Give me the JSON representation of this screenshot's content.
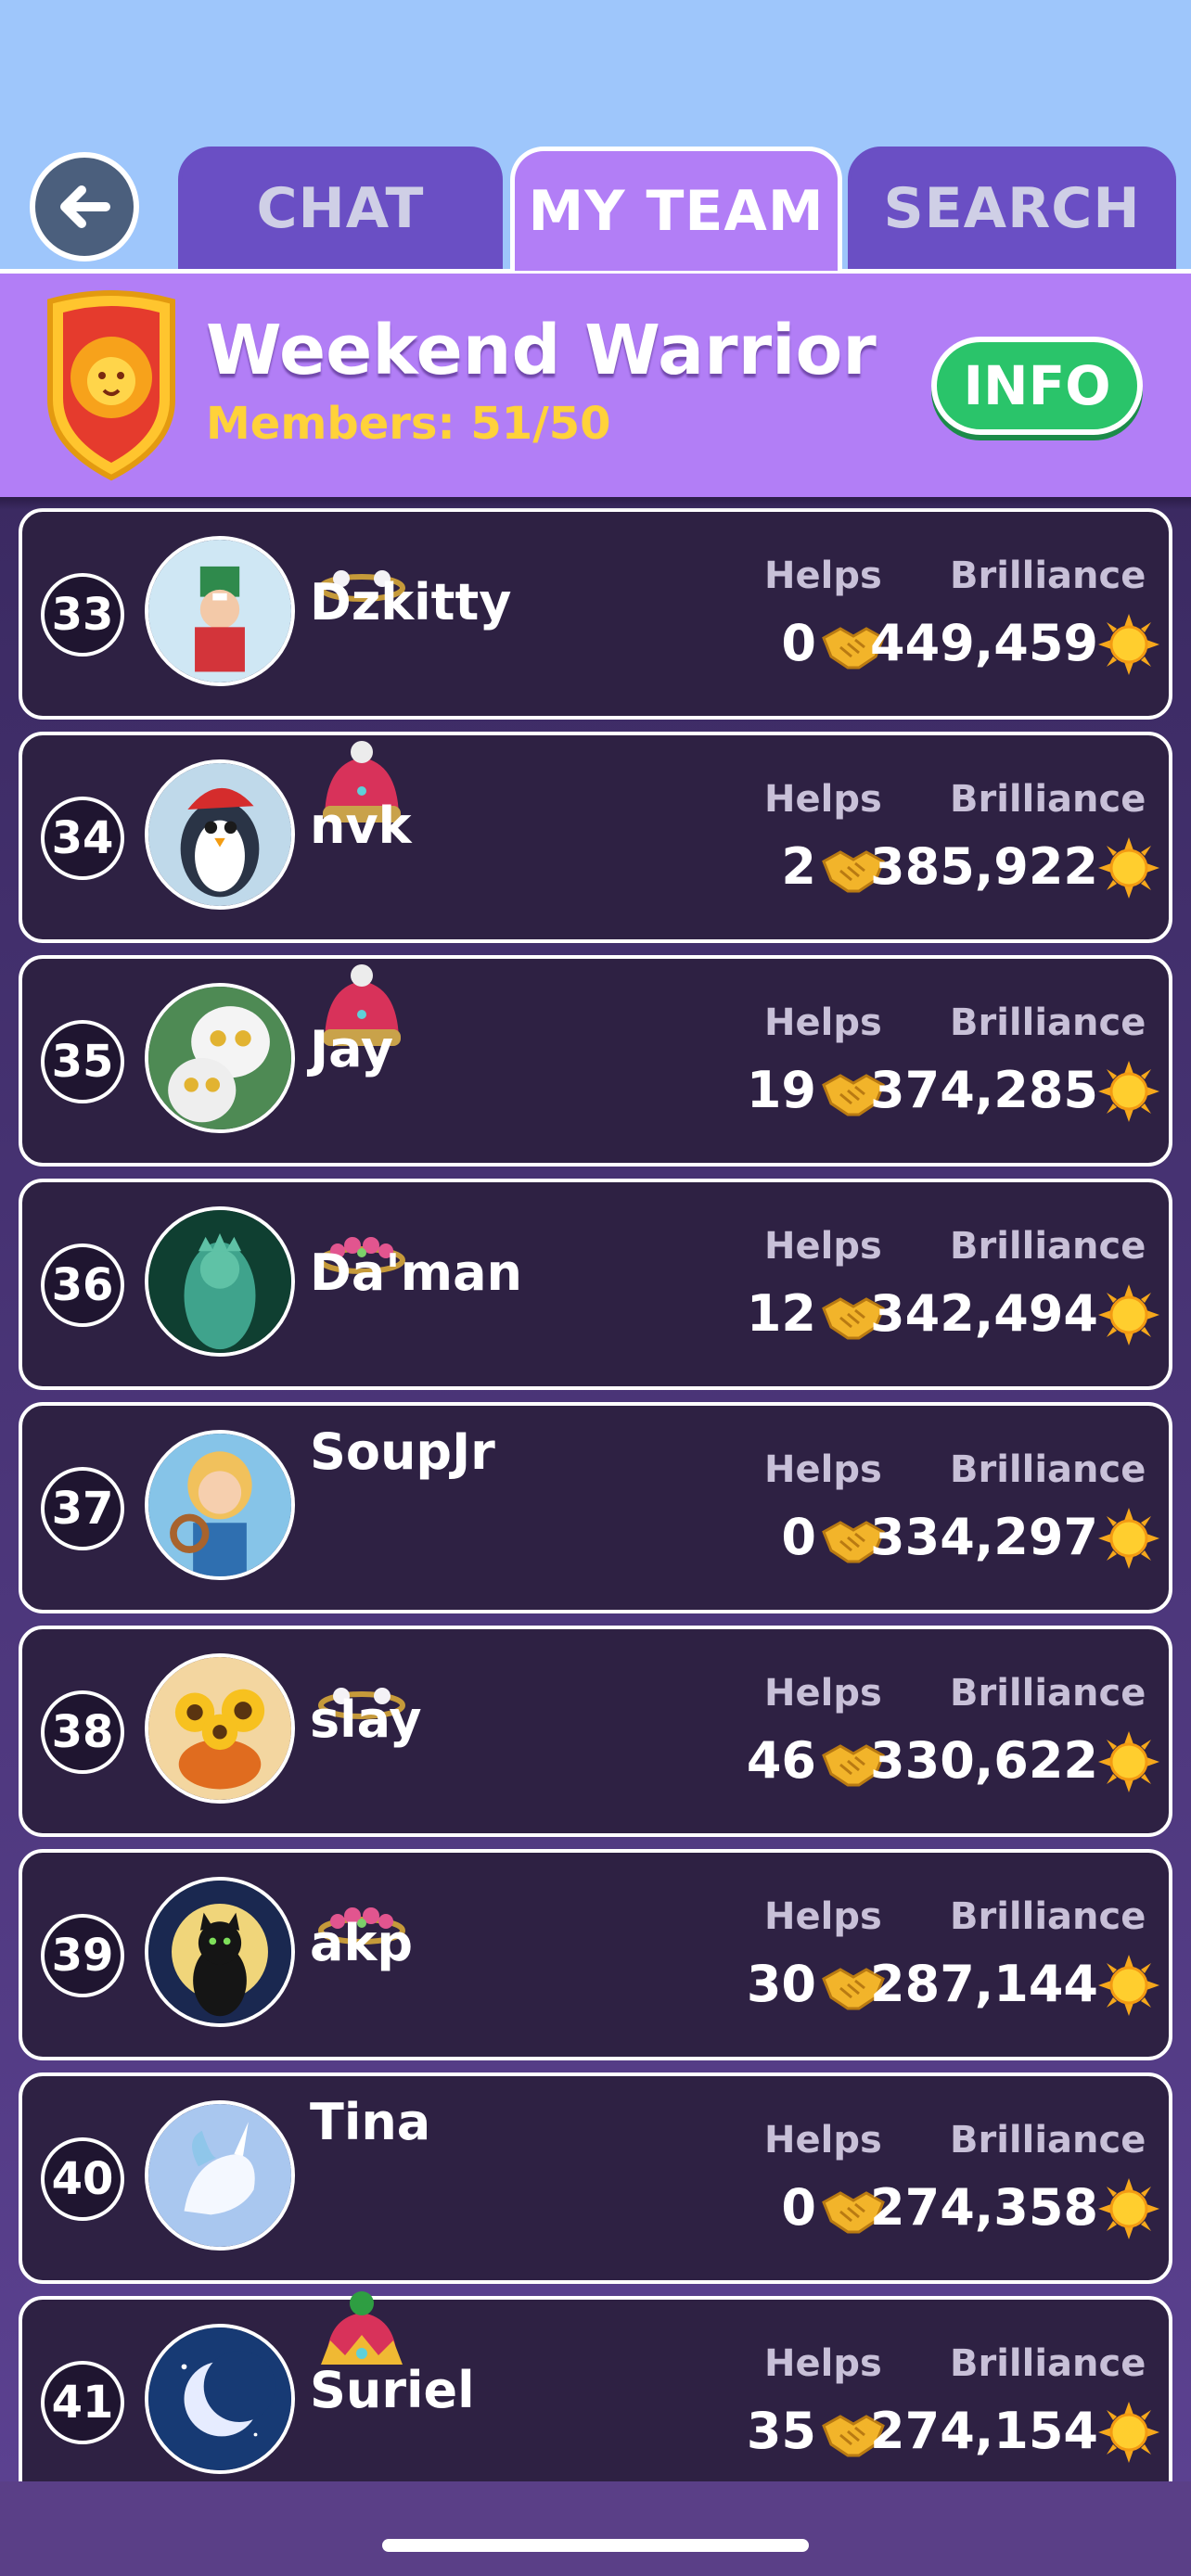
{
  "header": {
    "back_icon": "arrow-left-icon",
    "tabs": [
      {
        "label": "CHAT",
        "active": false
      },
      {
        "label": "MY TEAM",
        "active": true
      },
      {
        "label": "SEARCH",
        "active": false
      }
    ]
  },
  "team": {
    "name": "Weekend Warrior",
    "members_label": "Members: 51/50",
    "info_label": "INFO",
    "badge_icon": "lion-shield-icon"
  },
  "columns": {
    "helps_label": "Helps",
    "brilliance_label": "Brilliance"
  },
  "members": [
    {
      "rank": "33",
      "name": "Dzkitty",
      "helps": "0",
      "brilliance": "449,459",
      "crown": "pearl-tiara",
      "avatar": "nutcracker-avatar"
    },
    {
      "rank": "34",
      "name": "nvk",
      "helps": "2",
      "brilliance": "385,922",
      "crown": "pink-knit-hat",
      "avatar": "penguin-avatar"
    },
    {
      "rank": "35",
      "name": "Jay",
      "helps": "19",
      "brilliance": "374,285",
      "crown": "pink-knit-hat",
      "avatar": "snowy-owls-avatar"
    },
    {
      "rank": "36",
      "name": "Da'man",
      "helps": "12",
      "brilliance": "342,494",
      "crown": "flower-tiara",
      "avatar": "liberty-statue-avatar"
    },
    {
      "rank": "37",
      "name": "SoupJr",
      "helps": "0",
      "brilliance": "334,297",
      "crown": "",
      "avatar": "pretzel-girl-avatar"
    },
    {
      "rank": "38",
      "name": "slay",
      "helps": "46",
      "brilliance": "330,622",
      "crown": "pearl-tiara",
      "avatar": "sunflowers-avatar"
    },
    {
      "rank": "39",
      "name": "akp",
      "helps": "30",
      "brilliance": "287,144",
      "crown": "flower-tiara",
      "avatar": "black-cat-avatar"
    },
    {
      "rank": "40",
      "name": "Tina",
      "helps": "0",
      "brilliance": "274,358",
      "crown": "",
      "avatar": "unicorn-avatar"
    },
    {
      "rank": "41",
      "name": "Suriel",
      "helps": "35",
      "brilliance": "274,154",
      "crown": "jeweled-crown-hat",
      "avatar": "crescent-moon-avatar"
    }
  ],
  "colors": {
    "sky": "#9ec6fb",
    "header_purple": "#b27ef6",
    "tab_purple": "#6a4fc4",
    "row_bg": "#2e2143",
    "info_green": "#2ac46a",
    "members_yellow": "#ffd23a"
  }
}
